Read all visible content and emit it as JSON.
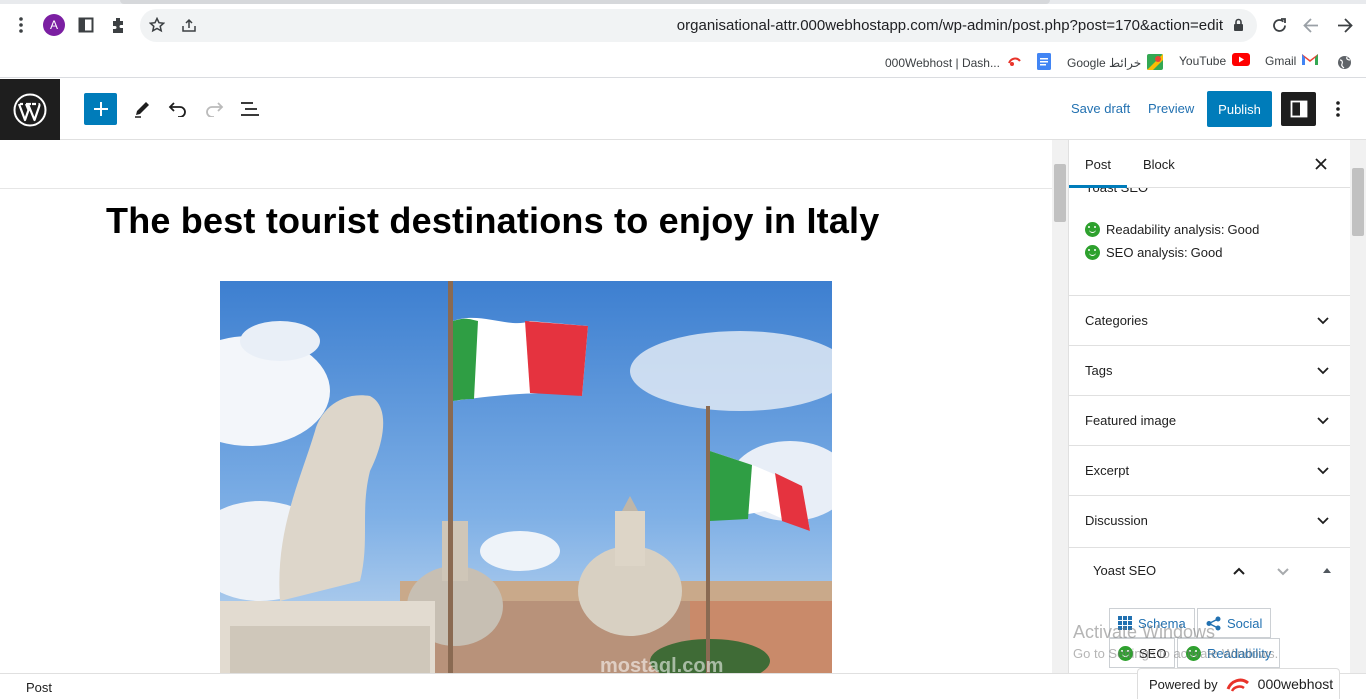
{
  "browser": {
    "avatar_letter": "A",
    "url": "organisational-attr.000webhostapp.com/wp-admin/post.php?post=170&action=edit",
    "bookmarks": [
      {
        "label": "000Webhost | Dash...",
        "icon": "webhost-icon"
      },
      {
        "label": "Google خرائط",
        "icon": "maps-icon"
      },
      {
        "label": "YouTube",
        "icon": "youtube-icon"
      },
      {
        "label": "Gmail",
        "icon": "gmail-icon"
      }
    ]
  },
  "toolbar": {
    "save_draft": "Save draft",
    "preview": "Preview",
    "publish": "Publish"
  },
  "editor": {
    "post_title": "The best tourist destinations to enjoy in Italy"
  },
  "sidebar": {
    "tabs": [
      "Post",
      "Block"
    ],
    "yoast_cut_title": "Yoast SEO",
    "readability_label": "Readability analysis:",
    "readability_value": "Good",
    "seo_label": "SEO analysis:",
    "seo_value": "Good",
    "panels": [
      "Categories",
      "Tags",
      "Featured image",
      "Excerpt",
      "Discussion"
    ],
    "yoast_title": "Yoast SEO",
    "yoast_tabs": [
      "Schema",
      "Social",
      "SEO",
      "Readability"
    ]
  },
  "footer": {
    "breadcrumb": "Post",
    "powered_by": "Powered by",
    "powered_brand": "000webhost"
  },
  "overlay": {
    "activate_title": "Activate Windows",
    "activate_sub": "Go to Settings to activate Windows.",
    "image_watermark": "mostaql.com"
  },
  "colors": {
    "accent": "#007cba",
    "good": "#2ea12e",
    "dark": "#1e1e1e"
  }
}
